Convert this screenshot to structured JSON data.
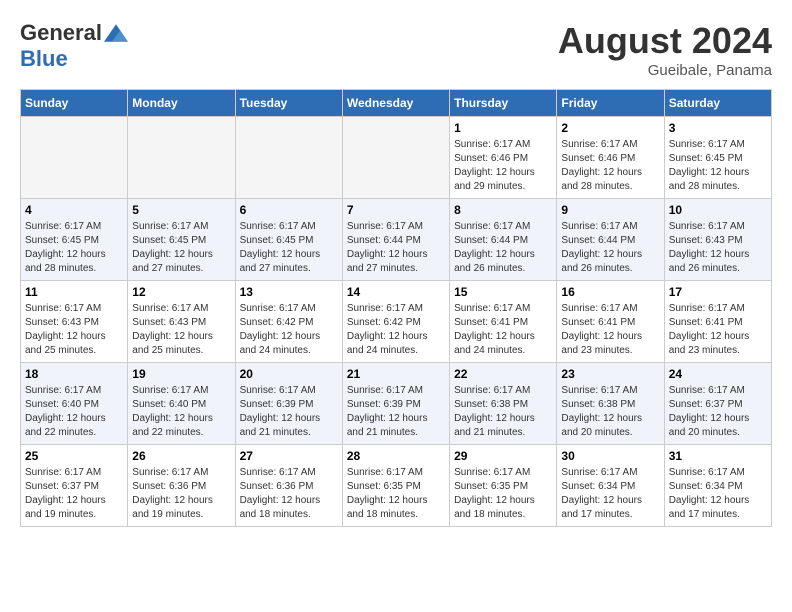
{
  "header": {
    "logo_general": "General",
    "logo_blue": "Blue",
    "month_year": "August 2024",
    "location": "Gueibale, Panama"
  },
  "days_of_week": [
    "Sunday",
    "Monday",
    "Tuesday",
    "Wednesday",
    "Thursday",
    "Friday",
    "Saturday"
  ],
  "weeks": [
    {
      "days": [
        {
          "num": "",
          "empty": true
        },
        {
          "num": "",
          "empty": true
        },
        {
          "num": "",
          "empty": true
        },
        {
          "num": "",
          "empty": true
        },
        {
          "num": "1",
          "sunrise": "Sunrise: 6:17 AM",
          "sunset": "Sunset: 6:46 PM",
          "daylight": "Daylight: 12 hours and 29 minutes."
        },
        {
          "num": "2",
          "sunrise": "Sunrise: 6:17 AM",
          "sunset": "Sunset: 6:46 PM",
          "daylight": "Daylight: 12 hours and 28 minutes."
        },
        {
          "num": "3",
          "sunrise": "Sunrise: 6:17 AM",
          "sunset": "Sunset: 6:45 PM",
          "daylight": "Daylight: 12 hours and 28 minutes."
        }
      ]
    },
    {
      "days": [
        {
          "num": "4",
          "sunrise": "Sunrise: 6:17 AM",
          "sunset": "Sunset: 6:45 PM",
          "daylight": "Daylight: 12 hours and 28 minutes."
        },
        {
          "num": "5",
          "sunrise": "Sunrise: 6:17 AM",
          "sunset": "Sunset: 6:45 PM",
          "daylight": "Daylight: 12 hours and 27 minutes."
        },
        {
          "num": "6",
          "sunrise": "Sunrise: 6:17 AM",
          "sunset": "Sunset: 6:45 PM",
          "daylight": "Daylight: 12 hours and 27 minutes."
        },
        {
          "num": "7",
          "sunrise": "Sunrise: 6:17 AM",
          "sunset": "Sunset: 6:44 PM",
          "daylight": "Daylight: 12 hours and 27 minutes."
        },
        {
          "num": "8",
          "sunrise": "Sunrise: 6:17 AM",
          "sunset": "Sunset: 6:44 PM",
          "daylight": "Daylight: 12 hours and 26 minutes."
        },
        {
          "num": "9",
          "sunrise": "Sunrise: 6:17 AM",
          "sunset": "Sunset: 6:44 PM",
          "daylight": "Daylight: 12 hours and 26 minutes."
        },
        {
          "num": "10",
          "sunrise": "Sunrise: 6:17 AM",
          "sunset": "Sunset: 6:43 PM",
          "daylight": "Daylight: 12 hours and 26 minutes."
        }
      ]
    },
    {
      "days": [
        {
          "num": "11",
          "sunrise": "Sunrise: 6:17 AM",
          "sunset": "Sunset: 6:43 PM",
          "daylight": "Daylight: 12 hours and 25 minutes."
        },
        {
          "num": "12",
          "sunrise": "Sunrise: 6:17 AM",
          "sunset": "Sunset: 6:43 PM",
          "daylight": "Daylight: 12 hours and 25 minutes."
        },
        {
          "num": "13",
          "sunrise": "Sunrise: 6:17 AM",
          "sunset": "Sunset: 6:42 PM",
          "daylight": "Daylight: 12 hours and 24 minutes."
        },
        {
          "num": "14",
          "sunrise": "Sunrise: 6:17 AM",
          "sunset": "Sunset: 6:42 PM",
          "daylight": "Daylight: 12 hours and 24 minutes."
        },
        {
          "num": "15",
          "sunrise": "Sunrise: 6:17 AM",
          "sunset": "Sunset: 6:41 PM",
          "daylight": "Daylight: 12 hours and 24 minutes."
        },
        {
          "num": "16",
          "sunrise": "Sunrise: 6:17 AM",
          "sunset": "Sunset: 6:41 PM",
          "daylight": "Daylight: 12 hours and 23 minutes."
        },
        {
          "num": "17",
          "sunrise": "Sunrise: 6:17 AM",
          "sunset": "Sunset: 6:41 PM",
          "daylight": "Daylight: 12 hours and 23 minutes."
        }
      ]
    },
    {
      "days": [
        {
          "num": "18",
          "sunrise": "Sunrise: 6:17 AM",
          "sunset": "Sunset: 6:40 PM",
          "daylight": "Daylight: 12 hours and 22 minutes."
        },
        {
          "num": "19",
          "sunrise": "Sunrise: 6:17 AM",
          "sunset": "Sunset: 6:40 PM",
          "daylight": "Daylight: 12 hours and 22 minutes."
        },
        {
          "num": "20",
          "sunrise": "Sunrise: 6:17 AM",
          "sunset": "Sunset: 6:39 PM",
          "daylight": "Daylight: 12 hours and 21 minutes."
        },
        {
          "num": "21",
          "sunrise": "Sunrise: 6:17 AM",
          "sunset": "Sunset: 6:39 PM",
          "daylight": "Daylight: 12 hours and 21 minutes."
        },
        {
          "num": "22",
          "sunrise": "Sunrise: 6:17 AM",
          "sunset": "Sunset: 6:38 PM",
          "daylight": "Daylight: 12 hours and 21 minutes."
        },
        {
          "num": "23",
          "sunrise": "Sunrise: 6:17 AM",
          "sunset": "Sunset: 6:38 PM",
          "daylight": "Daylight: 12 hours and 20 minutes."
        },
        {
          "num": "24",
          "sunrise": "Sunrise: 6:17 AM",
          "sunset": "Sunset: 6:37 PM",
          "daylight": "Daylight: 12 hours and 20 minutes."
        }
      ]
    },
    {
      "days": [
        {
          "num": "25",
          "sunrise": "Sunrise: 6:17 AM",
          "sunset": "Sunset: 6:37 PM",
          "daylight": "Daylight: 12 hours and 19 minutes."
        },
        {
          "num": "26",
          "sunrise": "Sunrise: 6:17 AM",
          "sunset": "Sunset: 6:36 PM",
          "daylight": "Daylight: 12 hours and 19 minutes."
        },
        {
          "num": "27",
          "sunrise": "Sunrise: 6:17 AM",
          "sunset": "Sunset: 6:36 PM",
          "daylight": "Daylight: 12 hours and 18 minutes."
        },
        {
          "num": "28",
          "sunrise": "Sunrise: 6:17 AM",
          "sunset": "Sunset: 6:35 PM",
          "daylight": "Daylight: 12 hours and 18 minutes."
        },
        {
          "num": "29",
          "sunrise": "Sunrise: 6:17 AM",
          "sunset": "Sunset: 6:35 PM",
          "daylight": "Daylight: 12 hours and 18 minutes."
        },
        {
          "num": "30",
          "sunrise": "Sunrise: 6:17 AM",
          "sunset": "Sunset: 6:34 PM",
          "daylight": "Daylight: 12 hours and 17 minutes."
        },
        {
          "num": "31",
          "sunrise": "Sunrise: 6:17 AM",
          "sunset": "Sunset: 6:34 PM",
          "daylight": "Daylight: 12 hours and 17 minutes."
        }
      ]
    }
  ]
}
